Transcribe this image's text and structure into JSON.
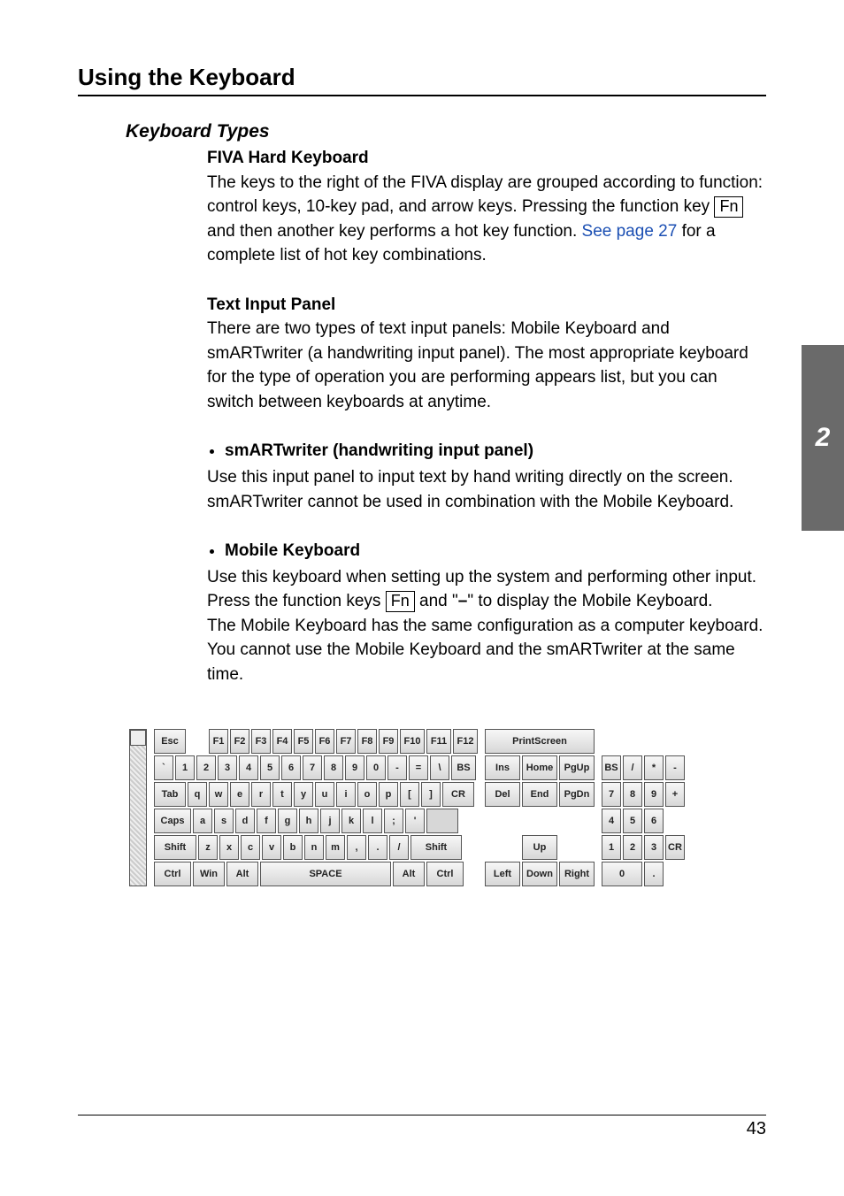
{
  "title": "Using the Keyboard",
  "section_tab": "2",
  "page_number": "43",
  "subheading": "Keyboard Types",
  "sections": {
    "fiva": {
      "heading": "FIVA Hard Keyboard",
      "p1a": "The keys to the right of the FIVA display are grouped according to function: control keys, 10-key pad, and arrow keys. Pressing the function key ",
      "fn": "Fn",
      "p1b": " and then another key performs a hot key function. ",
      "link": "See page 27",
      "p1c": " for a complete list of hot key combinations."
    },
    "text_input": {
      "heading": "Text Input Panel",
      "p": "There are two types of text input panels: Mobile Keyboard and smARTwriter (a handwriting input panel). The most appropriate keyboard for the type of operation you are performing appears list, but you can switch between keyboards at anytime."
    },
    "smart": {
      "heading": "smARTwriter (handwriting input panel)",
      "p": "Use this input panel to input text by hand writing directly on the screen. smARTwriter cannot be used in combination with the Mobile Keyboard."
    },
    "mobile": {
      "heading": "Mobile Keyboard",
      "p1a": "Use this keyboard when setting up the system and performing other input. Press the function keys ",
      "fn": "Fn",
      "p1b": " and \"",
      "dash": "–",
      "p1c": "\" to display the Mobile Keyboard.",
      "p2": "The Mobile Keyboard has the same configuration as a computer keyboard. You cannot use the Mobile Keyboard and the smARTwriter at the same time."
    }
  },
  "keyboard": {
    "main": [
      [
        "Esc",
        "",
        "F1",
        "F2",
        "F3",
        "F4",
        "F5",
        "F6",
        "F7",
        "F8",
        "F9",
        "F10",
        "F11",
        "F12"
      ],
      [
        "`",
        "1",
        "2",
        "3",
        "4",
        "5",
        "6",
        "7",
        "8",
        "9",
        "0",
        "-",
        "=",
        "\\",
        "BS"
      ],
      [
        "Tab",
        "q",
        "w",
        "e",
        "r",
        "t",
        "y",
        "u",
        "i",
        "o",
        "p",
        "[",
        "]",
        "CR"
      ],
      [
        "Caps",
        "a",
        "s",
        "d",
        "f",
        "g",
        "h",
        "j",
        "k",
        "l",
        ";",
        "'"
      ],
      [
        "Shift",
        "z",
        "x",
        "c",
        "v",
        "b",
        "n",
        "m",
        ",",
        ".",
        "/",
        "Shift"
      ],
      [
        "Ctrl",
        "Win",
        "Alt",
        "SPACE",
        "Alt",
        "Ctrl"
      ]
    ],
    "nav": [
      [
        "PrintScreen"
      ],
      [
        "Ins",
        "Home",
        "PgUp"
      ],
      [
        "Del",
        "End",
        "PgDn"
      ],
      [],
      [
        "Up"
      ],
      [
        "Left",
        "Down",
        "Right"
      ]
    ],
    "num": [
      [],
      [
        "BS",
        "/",
        "*",
        "-"
      ],
      [
        "7",
        "8",
        "9",
        "+"
      ],
      [
        "4",
        "5",
        "6"
      ],
      [
        "1",
        "2",
        "3",
        "CR"
      ],
      [
        "0",
        "."
      ]
    ]
  }
}
